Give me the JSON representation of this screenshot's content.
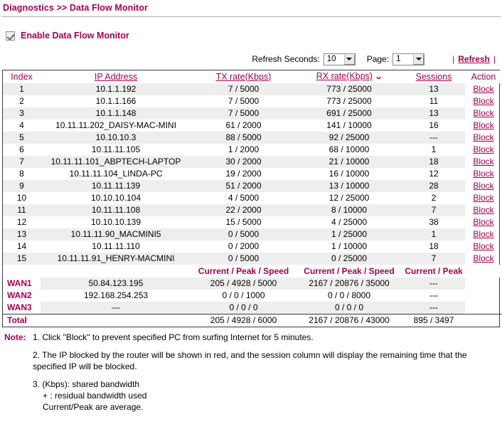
{
  "page": {
    "breadcrumb": "Diagnostics >> Data Flow Monitor",
    "enable_label": "Enable Data Flow Monitor"
  },
  "controls": {
    "refresh_seconds_label": "Refresh Seconds:",
    "refresh_seconds_value": "10",
    "page_label": "Page:",
    "page_value": "1",
    "divider_left": "|",
    "divider_right": "|",
    "refresh_link": "Refresh"
  },
  "table": {
    "headers": {
      "index": "Index",
      "ip": "IP Address",
      "tx": "TX rate(Kbps)",
      "rx": "RX rate(Kbps)",
      "rx_sort_caret": "⌄",
      "sessions": "Sessions",
      "action": "Action"
    },
    "action_label": "Block",
    "rows": [
      {
        "index": "1",
        "ip": "10.1.1.192",
        "tx": "7 / 5000",
        "rx": "773 / 25000",
        "sessions": "13",
        "action": "Block"
      },
      {
        "index": "2",
        "ip": "10.1.1.166",
        "tx": "7 / 5000",
        "rx": "773 / 25000",
        "sessions": "11",
        "action": "Block"
      },
      {
        "index": "3",
        "ip": "10.1.1.148",
        "tx": "7 / 5000",
        "rx": "691 / 25000",
        "sessions": "13",
        "action": "Block"
      },
      {
        "index": "4",
        "ip": "10.11.11.202_DAISY-MAC-MINI",
        "tx": "61 / 2000",
        "rx": "141 / 10000",
        "sessions": "16",
        "action": "Block"
      },
      {
        "index": "5",
        "ip": "10.10.10.3",
        "tx": "88 / 5000",
        "rx": "92 / 25000",
        "sessions": "---",
        "action": "Block"
      },
      {
        "index": "6",
        "ip": "10.11.11.105",
        "tx": "1 / 2000",
        "rx": "68 / 10000",
        "sessions": "1",
        "action": "Block"
      },
      {
        "index": "7",
        "ip": "10.11.11.101_ABPTECH-LAPTOP",
        "tx": "30 / 2000",
        "rx": "21 / 10000",
        "sessions": "18",
        "action": "Block"
      },
      {
        "index": "8",
        "ip": "10.11.11.104_LINDA-PC",
        "tx": "19 / 2000",
        "rx": "16 / 10000",
        "sessions": "12",
        "action": "Block"
      },
      {
        "index": "9",
        "ip": "10.11.11.139",
        "tx": "51 / 2000",
        "rx": "13 / 10000",
        "sessions": "28",
        "action": "Block"
      },
      {
        "index": "10",
        "ip": "10.10.10.104",
        "tx": "4 / 5000",
        "rx": "12 / 25000",
        "sessions": "2",
        "action": "Block"
      },
      {
        "index": "11",
        "ip": "10.11.11.108",
        "tx": "22 / 2000",
        "rx": "8 / 10000",
        "sessions": "7",
        "action": "Block"
      },
      {
        "index": "12",
        "ip": "10.10.10.139",
        "tx": "15 / 5000",
        "rx": "4 / 25000",
        "sessions": "38",
        "action": "Block"
      },
      {
        "index": "13",
        "ip": "10.11.11.90_MACMINI5",
        "tx": "0 / 5000",
        "rx": "1 / 25000",
        "sessions": "1",
        "action": "Block"
      },
      {
        "index": "14",
        "ip": "10.11.11.110",
        "tx": "0 / 2000",
        "rx": "1 / 10000",
        "sessions": "18",
        "action": "Block"
      },
      {
        "index": "15",
        "ip": "10.11.11.91_HENRY-MACMINI",
        "tx": "0 / 5000",
        "rx": "0 / 25000",
        "sessions": "7",
        "action": "Block"
      }
    ],
    "legend": {
      "tx": "Current / Peak / Speed",
      "rx": "Current / Peak / Speed",
      "sessions": "Current / Peak"
    },
    "wan_rows": [
      {
        "label": "WAN1",
        "ip": "50.84.123.195",
        "tx": "205 / 4928 / 5000",
        "rx": "2167 / 20876 / 35000",
        "sessions": "---"
      },
      {
        "label": "WAN2",
        "ip": "192.168.254.253",
        "tx": "0 / 0 / 1000",
        "rx": "0 / 0 / 8000",
        "sessions": "---"
      },
      {
        "label": "WAN3",
        "ip": "---",
        "tx": "0 / 0 / 0",
        "rx": "0 / 0 / 0",
        "sessions": "---"
      }
    ],
    "total_row": {
      "label": "Total",
      "ip": "",
      "tx": "205 / 4928 / 6000",
      "rx": "2167 / 20876 / 43000",
      "sessions": "895 / 3497"
    }
  },
  "notes": {
    "tag": "Note:",
    "items": [
      "1. Click \"Block\" to prevent specified PC from surfing Internet for 5 minutes.",
      "2. The IP blocked by the router will be shown in red, and the session column will display the remaining time that the specified IP will be blocked.",
      "3. (Kbps): shared bandwidth"
    ],
    "sub_items": [
      "+ : residual bandwidth used",
      "Current/Peak are average."
    ]
  },
  "colors": {
    "accent": "#A50050",
    "row_shade": "#EEEEEE",
    "border": "#3A3A3A"
  }
}
